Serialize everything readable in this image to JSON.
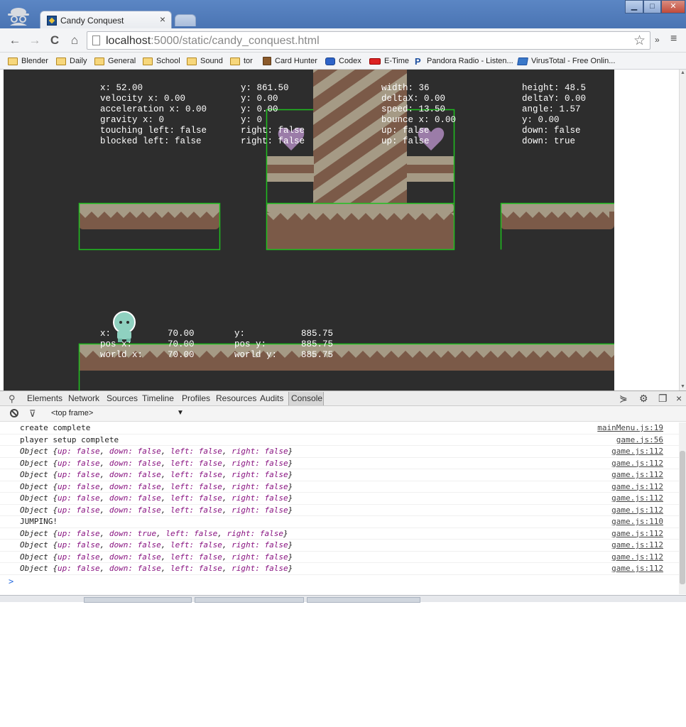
{
  "window": {
    "tab_title": "Candy Conquest",
    "tab_close": "×",
    "min_label": "▁",
    "max_label": "□",
    "close_label": "✕"
  },
  "toolbar": {
    "back": "←",
    "forward": "→",
    "reload": "C",
    "home": "⌂",
    "url_host": "localhost",
    "url_rest": ":5000/static/candy_conquest.html",
    "star": "☆",
    "more": "»",
    "menu": "≡"
  },
  "bookmarks": [
    {
      "label": "Blender",
      "icon": "folder-icon"
    },
    {
      "label": "Daily",
      "icon": "folder-icon"
    },
    {
      "label": "General",
      "icon": "folder-icon"
    },
    {
      "label": "School",
      "icon": "folder-icon"
    },
    {
      "label": "Sound",
      "icon": "folder-icon"
    },
    {
      "label": "tor",
      "icon": "folder-icon"
    },
    {
      "label": "Card Hunter",
      "icon": "card-hunter-icon"
    },
    {
      "label": "Codex",
      "icon": "codex-icon"
    },
    {
      "label": "E-Time",
      "icon": "etime-icon"
    },
    {
      "label": "Pandora Radio - Listen...",
      "icon": "pandora-icon"
    },
    {
      "label": "VirusTotal - Free Onlin...",
      "icon": "virustotal-icon"
    }
  ],
  "game": {
    "debug_col1": "x: 52.00\nvelocity x: 0.00\nacceleration x: 0.00\ngravity x: 0\ntouching left: false\nblocked left: false",
    "debug_col2": "y: 861.50\ny: 0.00\ny: 0.00\ny: 0\nright: false\nright: false",
    "debug_col3": "width: 36\ndeltaX: 0.00\nspeed: 13.50\nbounce x: 0.00\nup: false\nup: false",
    "debug_col4": "height: 48.5\ndeltaY: 0.00\nangle: 1.57\ny: 0.00\ndown: false\ndown: true",
    "camera_labels_a": "x:\npos x:\nworld x:",
    "camera_values_a": "70.00\n70.00\n70.00",
    "camera_labels_b": "y:\npos y:\nworld y:",
    "camera_values_b": "885.75\n885.75\n885.75"
  },
  "devtools": {
    "tabs": [
      "Elements",
      "Network",
      "Sources",
      "Timeline",
      "Profiles",
      "Resources",
      "Audits",
      "Console"
    ],
    "selected_tab": "Console",
    "frame": "<top frame>",
    "frame_arrow": "▼",
    "prompt": ">",
    "logs": [
      {
        "text": "create complete",
        "src": "mainMenu.js:19"
      },
      {
        "text": "player setup complete",
        "src": "game.js:56"
      },
      {
        "text": "Object {up: false, down: false, left: false, right: false}",
        "src": "game.js:112"
      },
      {
        "text": "Object {up: false, down: false, left: false, right: false}",
        "src": "game.js:112"
      },
      {
        "text": "Object {up: false, down: false, left: false, right: false}",
        "src": "game.js:112"
      },
      {
        "text": "Object {up: false, down: false, left: false, right: false}",
        "src": "game.js:112"
      },
      {
        "text": "Object {up: false, down: false, left: false, right: false}",
        "src": "game.js:112"
      },
      {
        "text": "Object {up: false, down: false, left: false, right: false}",
        "src": "game.js:112"
      },
      {
        "text": "JUMPING!",
        "src": "game.js:110"
      },
      {
        "text": "Object {up: false, down: true, left: false, right: false}",
        "src": "game.js:112"
      },
      {
        "text": "Object {up: false, down: false, left: false, right: false}",
        "src": "game.js:112"
      },
      {
        "text": "Object {up: false, down: false, left: false, right: false}",
        "src": "game.js:112"
      },
      {
        "text": "Object {up: false, down: false, left: false, right: false}",
        "src": "game.js:112"
      }
    ]
  },
  "colors": {
    "game_bg": "#2d2d2d",
    "hitbox": "#1fbf1f",
    "chocolate": "#7b5a48",
    "cream": "#a59a85",
    "titlebar": "#4a74b3",
    "console_keyword": "#881280"
  }
}
